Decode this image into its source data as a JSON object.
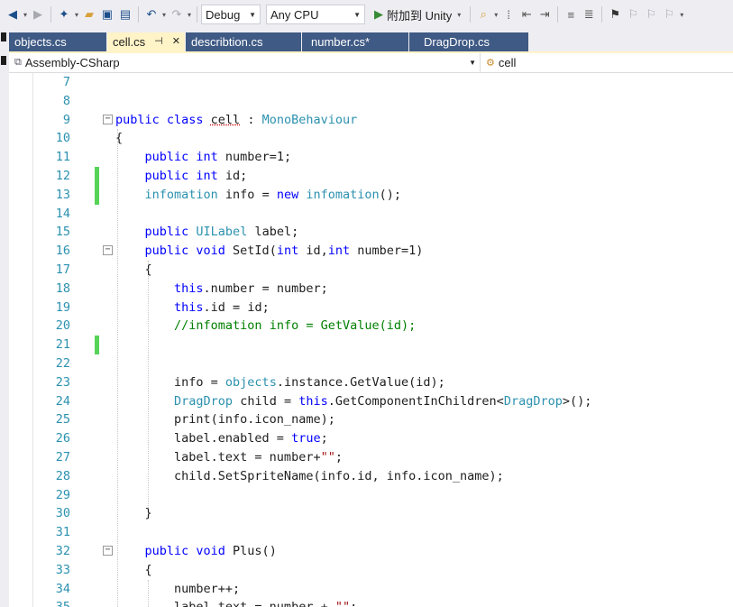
{
  "toolbar": {
    "config": "Debug",
    "platform": "Any CPU",
    "run_label": "附加到 Unity"
  },
  "tabs": [
    {
      "label": "objects.cs",
      "active": false
    },
    {
      "label": "cell.cs",
      "active": true
    },
    {
      "label": "describtion.cs",
      "active": false
    },
    {
      "label": "number.cs*",
      "active": false
    },
    {
      "label": "DragDrop.cs",
      "active": false
    }
  ],
  "nav": {
    "project": "Assembly-CSharp",
    "member": "cell"
  },
  "code_lines": [
    {
      "n": "7",
      "tokens": []
    },
    {
      "n": "8",
      "tokens": []
    },
    {
      "n": "9",
      "fold": true,
      "tokens": [
        [
          "kw",
          "public class "
        ],
        [
          "squig",
          "cell"
        ],
        [
          "tx",
          " : "
        ],
        [
          "ty",
          "MonoBehaviour"
        ]
      ]
    },
    {
      "n": "10",
      "tokens": [
        [
          "tx",
          "{"
        ]
      ]
    },
    {
      "n": "11",
      "tokens": [
        [
          "tx",
          "    "
        ],
        [
          "kw",
          "public int"
        ],
        [
          "tx",
          " number=1;"
        ]
      ]
    },
    {
      "n": "12",
      "changed": true,
      "tokens": [
        [
          "tx",
          "    "
        ],
        [
          "kw",
          "public int"
        ],
        [
          "tx",
          " id;"
        ]
      ]
    },
    {
      "n": "13",
      "changed": true,
      "tokens": [
        [
          "tx",
          "    "
        ],
        [
          "ty",
          "infomation"
        ],
        [
          "tx",
          " info = "
        ],
        [
          "kw",
          "new "
        ],
        [
          "ty",
          "infomation"
        ],
        [
          "tx",
          "();"
        ]
      ]
    },
    {
      "n": "14",
      "tokens": []
    },
    {
      "n": "15",
      "tokens": [
        [
          "tx",
          "    "
        ],
        [
          "kw",
          "public "
        ],
        [
          "ty",
          "UILabel"
        ],
        [
          "tx",
          " label;"
        ]
      ]
    },
    {
      "n": "16",
      "fold": true,
      "tokens": [
        [
          "tx",
          "    "
        ],
        [
          "kw",
          "public void"
        ],
        [
          "tx",
          " SetId("
        ],
        [
          "kw",
          "int"
        ],
        [
          "tx",
          " id,"
        ],
        [
          "kw",
          "int"
        ],
        [
          "tx",
          " number=1)"
        ]
      ]
    },
    {
      "n": "17",
      "tokens": [
        [
          "tx",
          "    {"
        ]
      ]
    },
    {
      "n": "18",
      "tokens": [
        [
          "tx",
          "        "
        ],
        [
          "kw",
          "this"
        ],
        [
          "tx",
          ".number = number;"
        ]
      ]
    },
    {
      "n": "19",
      "tokens": [
        [
          "tx",
          "        "
        ],
        [
          "kw",
          "this"
        ],
        [
          "tx",
          ".id = id;"
        ]
      ]
    },
    {
      "n": "20",
      "tokens": [
        [
          "tx",
          "        "
        ],
        [
          "cm",
          "//infomation info = GetValue(id);"
        ]
      ]
    },
    {
      "n": "21",
      "changed": true,
      "tokens": []
    },
    {
      "n": "22",
      "tokens": []
    },
    {
      "n": "23",
      "tokens": [
        [
          "tx",
          "        info = "
        ],
        [
          "ty",
          "objects"
        ],
        [
          "tx",
          ".instance.GetValue(id);"
        ]
      ]
    },
    {
      "n": "24",
      "tokens": [
        [
          "tx",
          "        "
        ],
        [
          "ty",
          "DragDrop"
        ],
        [
          "tx",
          " child = "
        ],
        [
          "kw",
          "this"
        ],
        [
          "tx",
          ".GetComponentInChildren<"
        ],
        [
          "ty",
          "DragDrop"
        ],
        [
          "tx",
          ">();"
        ]
      ]
    },
    {
      "n": "25",
      "tokens": [
        [
          "tx",
          "        print(info.icon_name);"
        ]
      ]
    },
    {
      "n": "26",
      "tokens": [
        [
          "tx",
          "        label.enabled = "
        ],
        [
          "kw",
          "true"
        ],
        [
          "tx",
          ";"
        ]
      ]
    },
    {
      "n": "27",
      "tokens": [
        [
          "tx",
          "        label.text = number+"
        ],
        [
          "st",
          "\"\""
        ],
        [
          "tx",
          ";"
        ]
      ]
    },
    {
      "n": "28",
      "tokens": [
        [
          "tx",
          "        child.SetSpriteName(info.id, info.icon_name);"
        ]
      ]
    },
    {
      "n": "29",
      "tokens": []
    },
    {
      "n": "30",
      "tokens": [
        [
          "tx",
          "    }"
        ]
      ]
    },
    {
      "n": "31",
      "tokens": []
    },
    {
      "n": "32",
      "fold": true,
      "tokens": [
        [
          "tx",
          "    "
        ],
        [
          "kw",
          "public void"
        ],
        [
          "tx",
          " Plus()"
        ]
      ]
    },
    {
      "n": "33",
      "tokens": [
        [
          "tx",
          "    {"
        ]
      ]
    },
    {
      "n": "34",
      "tokens": [
        [
          "tx",
          "        number++;"
        ]
      ]
    },
    {
      "n": "35",
      "tokens": [
        [
          "tx",
          "        label.text = number + "
        ],
        [
          "st",
          "\"\""
        ],
        [
          "tx",
          ";"
        ]
      ]
    }
  ]
}
